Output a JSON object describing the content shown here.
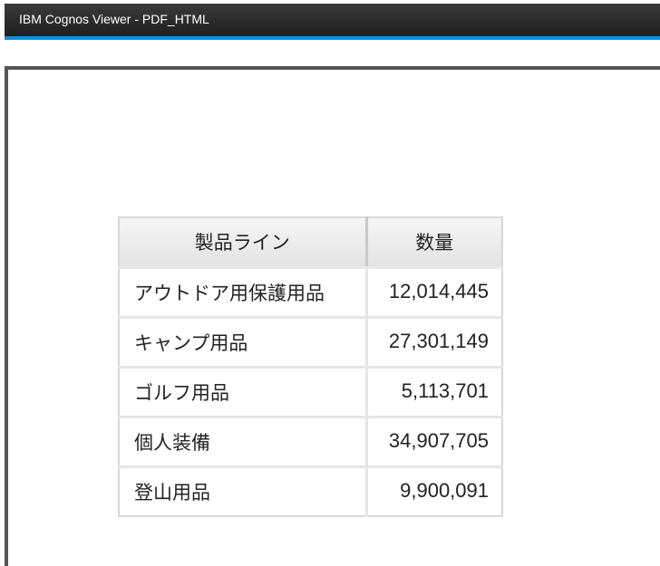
{
  "window": {
    "title": "IBM Cognos Viewer - PDF_HTML"
  },
  "colors": {
    "titlebar": "#2a2a2a",
    "accent": "#0c8fd1",
    "frame_border": "#555555",
    "table_border": "#d8d8d8"
  },
  "report": {
    "columns": [
      "製品ライン",
      "数量"
    ],
    "rows": [
      {
        "product_line": "アウトドア用保護用品",
        "quantity": "12,014,445"
      },
      {
        "product_line": "キャンプ用品",
        "quantity": "27,301,149"
      },
      {
        "product_line": "ゴルフ用品",
        "quantity": "5,113,701"
      },
      {
        "product_line": "個人装備",
        "quantity": "34,907,705"
      },
      {
        "product_line": "登山用品",
        "quantity": "9,900,091"
      }
    ]
  }
}
